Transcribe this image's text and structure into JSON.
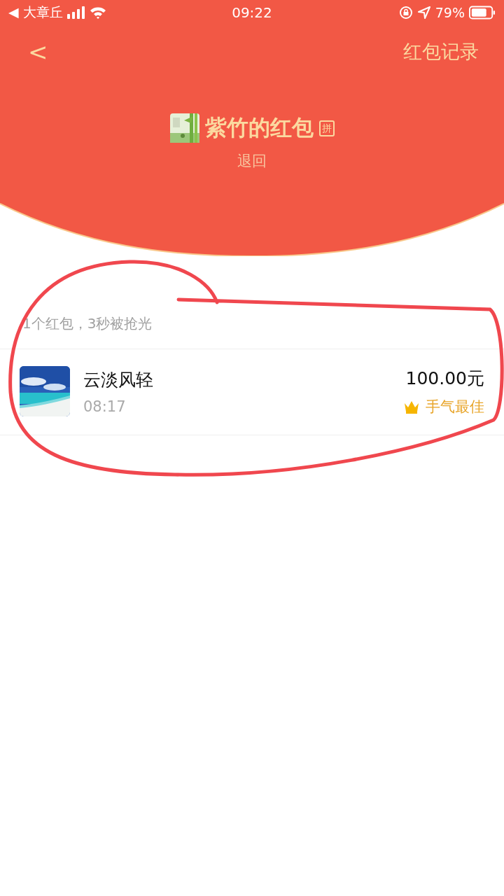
{
  "status_bar": {
    "back_label": "◀ 大章丘",
    "time": "09:22",
    "battery": "79%"
  },
  "nav": {
    "back": "<",
    "records": "红包记录"
  },
  "header": {
    "title": "紫竹的红包",
    "tag": "拼",
    "status": "退回"
  },
  "summary": "1个红包，3秒被抢光",
  "recipients": [
    {
      "name": "云淡风轻",
      "time": "08:17",
      "amount": "100.00元",
      "best": true,
      "best_label": "手气最佳"
    }
  ],
  "annotation": {
    "kind": "loop"
  }
}
